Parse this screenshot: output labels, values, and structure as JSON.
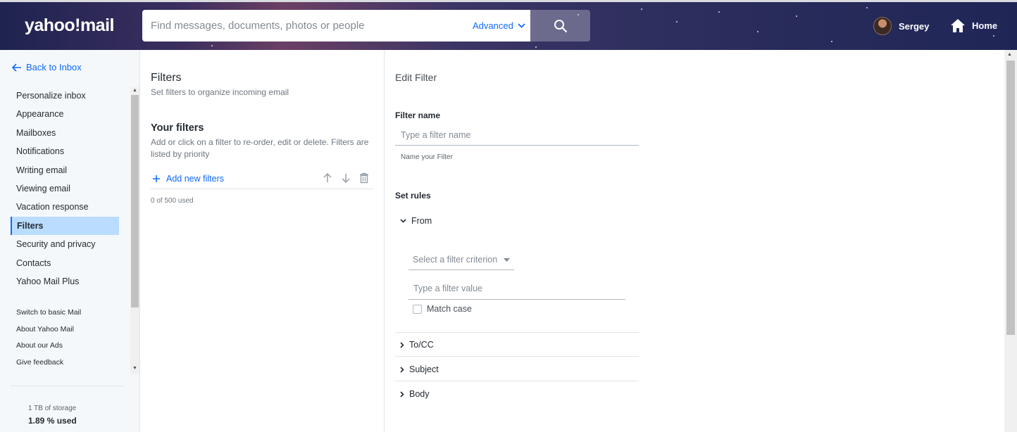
{
  "header": {
    "logo": "yahoo!mail",
    "search_placeholder": "Find messages, documents, photos or people",
    "advanced_label": "Advanced",
    "user_name": "Sergey",
    "home_label": "Home"
  },
  "sidebar": {
    "back_label": "Back to Inbox",
    "items": [
      {
        "label": "Personalize inbox"
      },
      {
        "label": "Appearance"
      },
      {
        "label": "Mailboxes"
      },
      {
        "label": "Notifications"
      },
      {
        "label": "Writing email"
      },
      {
        "label": "Viewing email"
      },
      {
        "label": "Vacation response"
      },
      {
        "label": "Filters",
        "active": true
      },
      {
        "label": "Security and privacy"
      },
      {
        "label": "Contacts"
      },
      {
        "label": "Yahoo Mail Plus"
      }
    ],
    "links": [
      {
        "label": "Switch to basic Mail"
      },
      {
        "label": "About Yahoo Mail"
      },
      {
        "label": "About our Ads"
      },
      {
        "label": "Give feedback"
      }
    ],
    "storage_text": "1 TB of storage",
    "storage_used": "1.89 % used"
  },
  "filters": {
    "title": "Filters",
    "subtitle": "Set filters to organize incoming email",
    "your_filters_title": "Your filters",
    "your_filters_desc": "Add or click on a filter to re-order, edit or delete. Filters are listed by priority",
    "add_label": "Add new filters",
    "used_text": "0 of 500 used"
  },
  "edit": {
    "title": "Edit Filter",
    "filter_name_label": "Filter name",
    "filter_name_placeholder": "Type a filter name",
    "filter_name_hint": "Name your Filter",
    "set_rules_label": "Set rules",
    "from_label": "From",
    "criterion_placeholder": "Select a filter criterion",
    "value_placeholder": "Type a filter value",
    "match_case_label": "Match case",
    "to_cc_label": "To/CC",
    "subject_label": "Subject",
    "body_label": "Body"
  },
  "colors": {
    "accent": "#0f69ff",
    "active_bg": "#b9dcff"
  }
}
